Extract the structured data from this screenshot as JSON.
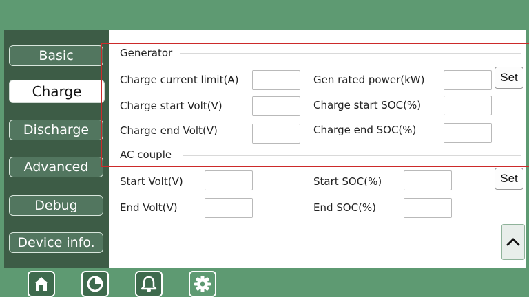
{
  "tabs": [
    {
      "label": "Basic"
    },
    {
      "label": "Charge"
    },
    {
      "label": "Discharge"
    },
    {
      "label": "Advanced"
    },
    {
      "label": "Debug"
    },
    {
      "label": "Device info."
    }
  ],
  "active_tab": "Charge",
  "generator": {
    "title": "Generator",
    "charge_current_limit": {
      "label": "Charge current limit(A)",
      "value": ""
    },
    "gen_rated_power": {
      "label": "Gen rated power(kW)",
      "value": ""
    },
    "charge_start_volt": {
      "label": "Charge start Volt(V)",
      "value": ""
    },
    "charge_start_soc": {
      "label": "Charge start SOC(%)",
      "value": ""
    },
    "charge_end_volt": {
      "label": "Charge end Volt(V)",
      "value": ""
    },
    "charge_end_soc": {
      "label": "Charge end SOC(%)",
      "value": ""
    },
    "set_label": "Set"
  },
  "ac_couple": {
    "title": "AC couple",
    "start_volt": {
      "label": "Start Volt(V)",
      "value": ""
    },
    "start_soc": {
      "label": "Start SOC(%)",
      "value": ""
    },
    "end_volt": {
      "label": "End Volt(V)",
      "value": ""
    },
    "end_soc": {
      "label": "End SOC(%)",
      "value": ""
    },
    "set_label": "Set"
  },
  "icons": {
    "scroll": "chevron-up-icon",
    "nav": [
      "home-icon",
      "pie-chart-icon",
      "bell-icon",
      "gear-icon"
    ]
  },
  "colors": {
    "frame": "#5e9a72",
    "sidebar": "#3d5c46",
    "tab": "#52765f",
    "highlight": "#cc2a2a"
  }
}
